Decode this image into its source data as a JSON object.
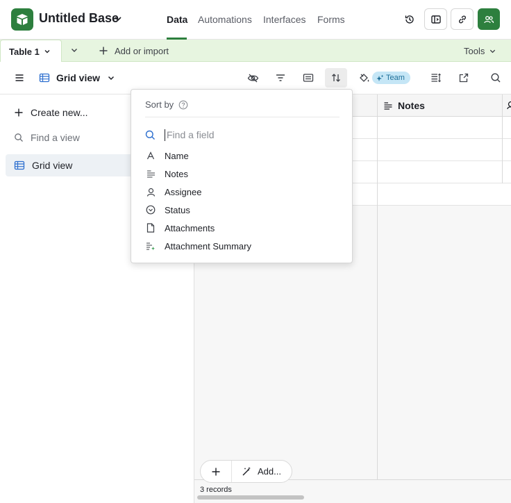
{
  "app": {
    "base_title": "Untitled Base",
    "nav_tabs": [
      {
        "label": "Data",
        "active": true
      },
      {
        "label": "Automations",
        "active": false
      },
      {
        "label": "Interfaces",
        "active": false
      },
      {
        "label": "Forms",
        "active": false
      }
    ],
    "brand_color": "#2d7f3e"
  },
  "table_bar": {
    "active_table": "Table 1",
    "add_or_import": "Add or import",
    "tools": "Tools",
    "background_color": "#e7f5e0"
  },
  "view_bar": {
    "view_name": "Grid view",
    "team_badge": "Team",
    "icons": [
      "hide-fields-icon",
      "filter-icon",
      "group-icon",
      "sort-icon",
      "color-icon",
      "row-height-icon",
      "share-view-icon",
      "search-icon"
    ],
    "active_icon": "sort-icon"
  },
  "sidebar": {
    "create_new": "Create new...",
    "find_view_placeholder": "Find a view",
    "views": [
      {
        "label": "Grid view",
        "selected": true
      }
    ]
  },
  "grid": {
    "visible_columns": [
      {
        "label": "Notes",
        "icon": "long-text-icon"
      }
    ],
    "row_count_shown": 3,
    "records_label": "3 records",
    "add_more_label": "Add..."
  },
  "sort_popover": {
    "title": "Sort by",
    "search_placeholder": "Find a field",
    "fields": [
      {
        "label": "Name",
        "icon": "single-line-text-icon"
      },
      {
        "label": "Notes",
        "icon": "long-text-icon"
      },
      {
        "label": "Assignee",
        "icon": "user-icon"
      },
      {
        "label": "Status",
        "icon": "single-select-icon"
      },
      {
        "label": "Attachments",
        "icon": "attachment-icon"
      },
      {
        "label": "Attachment Summary",
        "icon": "ai-summary-icon"
      }
    ]
  }
}
